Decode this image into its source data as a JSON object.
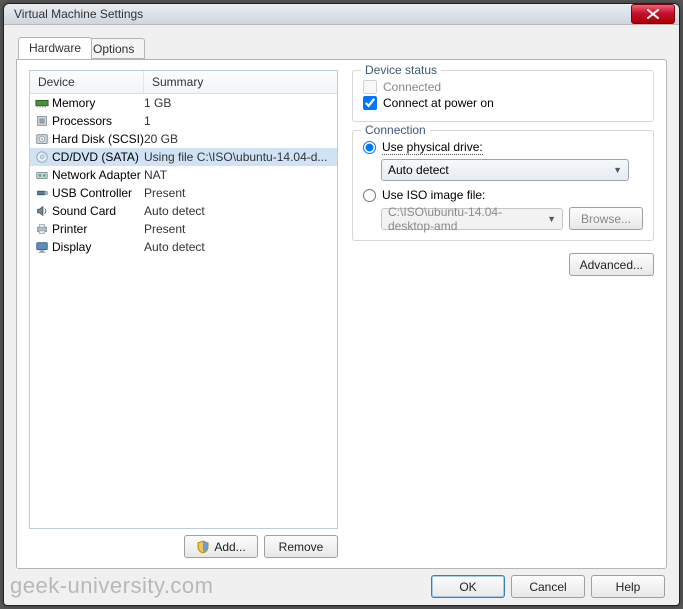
{
  "window": {
    "title": "Virtual Machine Settings"
  },
  "tabs": {
    "hardware": "Hardware",
    "options": "Options"
  },
  "table": {
    "head_device": "Device",
    "head_summary": "Summary",
    "rows": [
      {
        "name": "Memory",
        "summary": "1 GB",
        "icon": "memory"
      },
      {
        "name": "Processors",
        "summary": "1",
        "icon": "cpu"
      },
      {
        "name": "Hard Disk (SCSI)",
        "summary": "20 GB",
        "icon": "hdd"
      },
      {
        "name": "CD/DVD (SATA)",
        "summary": "Using file C:\\ISO\\ubuntu-14.04-d...",
        "icon": "cd",
        "selected": true
      },
      {
        "name": "Network Adapter",
        "summary": "NAT",
        "icon": "net"
      },
      {
        "name": "USB Controller",
        "summary": "Present",
        "icon": "usb"
      },
      {
        "name": "Sound Card",
        "summary": "Auto detect",
        "icon": "sound"
      },
      {
        "name": "Printer",
        "summary": "Present",
        "icon": "printer"
      },
      {
        "name": "Display",
        "summary": "Auto detect",
        "icon": "display"
      }
    ]
  },
  "buttons": {
    "add": "Add...",
    "remove": "Remove",
    "advanced": "Advanced...",
    "browse": "Browse...",
    "ok": "OK",
    "cancel": "Cancel",
    "help": "Help"
  },
  "status": {
    "legend": "Device status",
    "connected": "Connected",
    "connect_power": "Connect at power on"
  },
  "connection": {
    "legend": "Connection",
    "use_physical": "Use physical drive:",
    "auto_detect": "Auto detect",
    "use_iso": "Use ISO image file:",
    "iso_path": "C:\\ISO\\ubuntu-14.04-desktop-amd"
  },
  "watermark": "geek-university.com"
}
